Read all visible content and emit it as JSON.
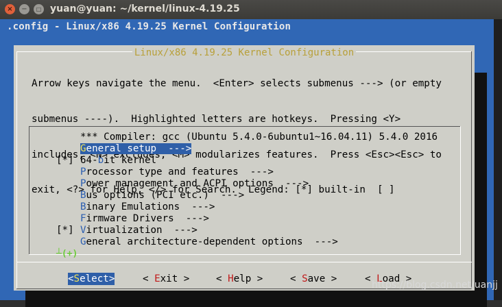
{
  "window": {
    "title": "yuan@yuan: ~/kernel/linux-4.19.25",
    "close_glyph": "×",
    "min_glyph": "−",
    "max_glyph": "□"
  },
  "terminal": {
    "config_header": ".config - Linux/x86 4.19.25 Kernel Configuration",
    "background_color": "#3067b5"
  },
  "dialog": {
    "title": "Linux/x86 4.19.25 Kernel Configuration",
    "help_lines": [
      "Arrow keys navigate the menu.  <Enter> selects submenus ---> (or empty",
      "submenus ----).  Highlighted letters are hotkeys.  Pressing <Y>",
      "includes, <N> excludes, <M> modularizes features.  Press <Esc><Esc> to",
      "exit, <?> for Help, </> for Search.  Legend: [*] built-in  [ ]"
    ],
    "menu_items": [
      {
        "mark": "",
        "hotkey": "",
        "rest": "*** Compiler: gcc (Ubuntu 5.4.0-6ubuntu1~16.04.11) 5.4.0 2016",
        "selected": false
      },
      {
        "mark": "",
        "hotkey": "G",
        "rest": "eneral setup  --->",
        "selected": true
      },
      {
        "mark": "[*]",
        "pre": "64-",
        "hotkey": "b",
        "rest": "it kernel",
        "selected": false
      },
      {
        "mark": "",
        "hotkey": "P",
        "rest": "rocessor type and features  --->",
        "selected": false
      },
      {
        "mark": "",
        "hotkey": "P",
        "rest": "ower management and ACPI options  --->",
        "selected": false
      },
      {
        "mark": "",
        "hotkey": "B",
        "rest": "us options (PCI etc.)  --->",
        "selected": false
      },
      {
        "mark": "",
        "hotkey": "B",
        "rest": "inary Emulations  --->",
        "selected": false
      },
      {
        "mark": "",
        "hotkey": "F",
        "rest": "irmware Drivers  --->",
        "selected": false
      },
      {
        "mark": "[*]",
        "hotkey": "V",
        "rest": "irtualization  --->",
        "selected": false
      },
      {
        "mark": "",
        "hotkey": "G",
        "rest": "eneral architecture-dependent options  --->",
        "selected": false
      }
    ],
    "more_indicator": "┴(+)",
    "buttons": [
      {
        "open": "<",
        "hotkey": "S",
        "rest": "elect",
        "close": ">",
        "active": true
      },
      {
        "open": "< ",
        "hotkey": "E",
        "rest": "xit",
        "close": " >",
        "active": false
      },
      {
        "open": "< ",
        "hotkey": "H",
        "rest": "elp",
        "close": " >",
        "active": false
      },
      {
        "open": "< ",
        "hotkey": "S",
        "rest": "ave",
        "close": " >",
        "active": false
      },
      {
        "open": "< ",
        "hotkey": "L",
        "rest": "oad",
        "close": " >",
        "active": false
      }
    ]
  },
  "watermark": "https://blog.csdn.net/uanjj"
}
